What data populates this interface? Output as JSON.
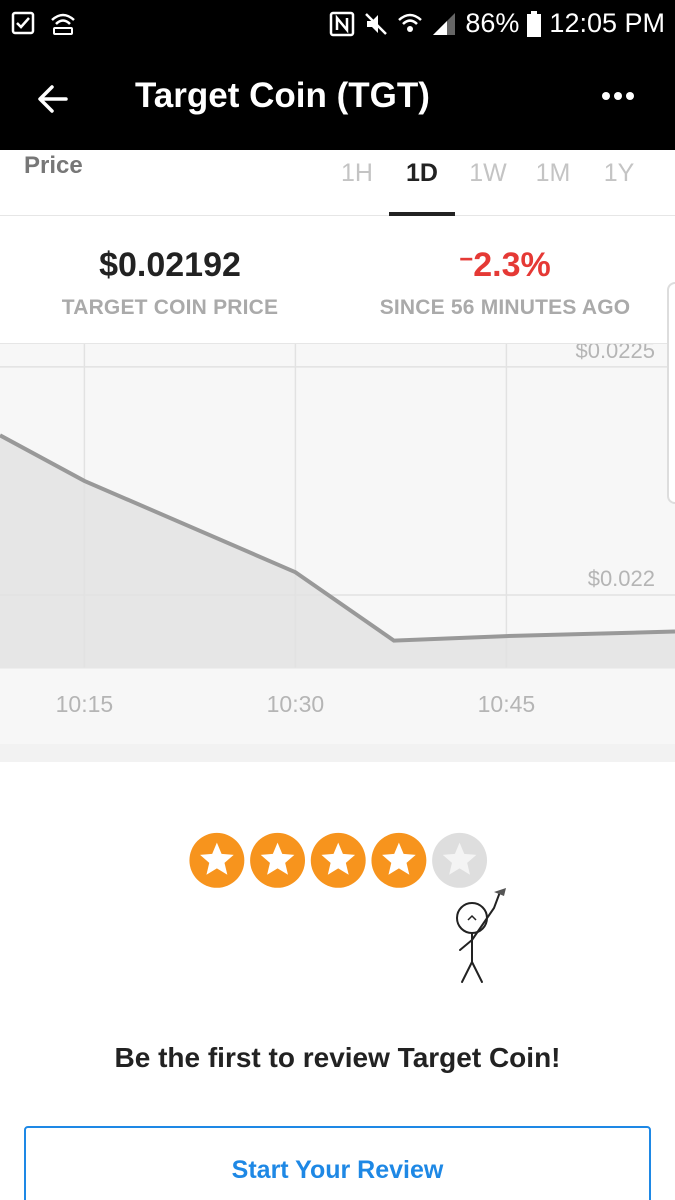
{
  "status_bar": {
    "battery": "86%",
    "time": "12:05 PM"
  },
  "app_bar": {
    "title": "Target Coin (TGT)"
  },
  "price_card": {
    "label": "Price",
    "tabs": [
      "1H",
      "1D",
      "1W",
      "1M",
      "1Y"
    ],
    "active_tab": "1D",
    "price_value": "$0.02192",
    "price_caption": "TARGET COIN PRICE",
    "change_sign": "−",
    "change_value": "2.3%",
    "change_caption": "SINCE 56 MINUTES AGO",
    "change_color": "#e53935"
  },
  "chart_data": {
    "type": "area",
    "x_tick_labels": [
      "10:15",
      "10:30",
      "10:45"
    ],
    "y_tick_labels": [
      "$0.0225",
      "$0.022"
    ],
    "x": [
      "10:09",
      "10:15",
      "10:30",
      "10:37",
      "10:45",
      "10:55"
    ],
    "values": [
      0.02235,
      0.02225,
      0.02205,
      0.0219,
      0.02191,
      0.02192
    ],
    "ylim": [
      0.02184,
      0.02255
    ],
    "grid": true,
    "line_color": "#999999",
    "fill_color": "#e6e6e6"
  },
  "review": {
    "stars_filled": 4,
    "stars_total": 5,
    "heading": "Be the first to review Target Coin!",
    "button_label": "Start Your Review",
    "accent": "#1e88e5",
    "star_color": "#f7941d"
  }
}
